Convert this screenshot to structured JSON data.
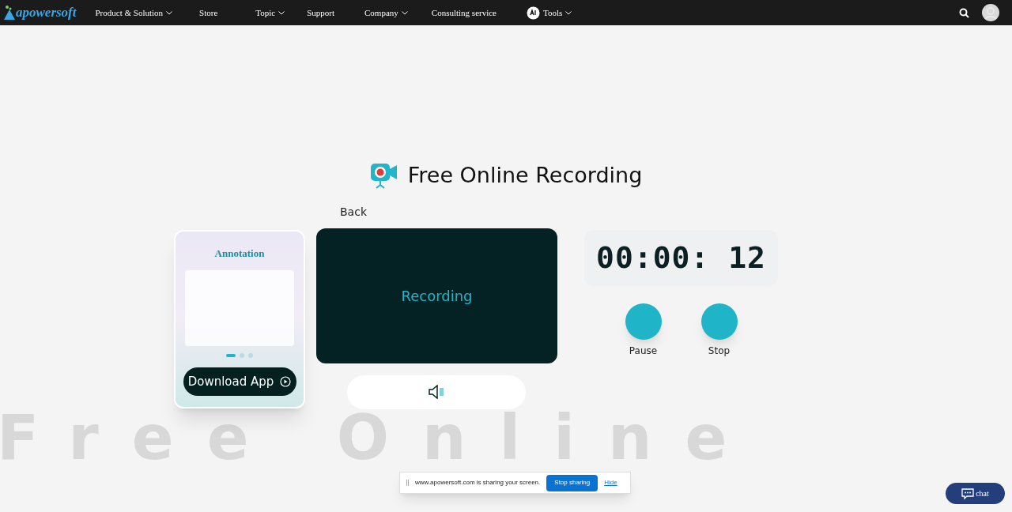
{
  "nav": {
    "logo": "apowersoft",
    "items": [
      {
        "label": "Product & Solution",
        "dropdown": true,
        "ai_badge": false
      },
      {
        "label": "Store",
        "dropdown": false,
        "ai_badge": false
      },
      {
        "label": "Topic",
        "dropdown": true,
        "ai_badge": false
      },
      {
        "label": "Support",
        "dropdown": false,
        "ai_badge": false
      },
      {
        "label": "Company",
        "dropdown": true,
        "ai_badge": false
      },
      {
        "label": "Consulting service",
        "dropdown": false,
        "ai_badge": false
      },
      {
        "label": "Tools",
        "dropdown": true,
        "ai_badge": true
      }
    ]
  },
  "title": "Free Online Recording",
  "promo_card": {
    "heading": "Annotation",
    "dots": [
      {
        "selected": true
      },
      {
        "selected": false
      },
      {
        "selected": false
      }
    ],
    "button": "Download App"
  },
  "back": "Back",
  "preview": {
    "status": "Recording"
  },
  "timer": "00:00: 12",
  "controls": [
    {
      "label": "Pause"
    },
    {
      "label": "Stop"
    }
  ],
  "background_text": "Free Online",
  "share_bar": {
    "message": "www.apowersoft.com is sharing your screen.",
    "stop": "Stop sharing",
    "hide": "Hide"
  },
  "chat": "chat"
}
